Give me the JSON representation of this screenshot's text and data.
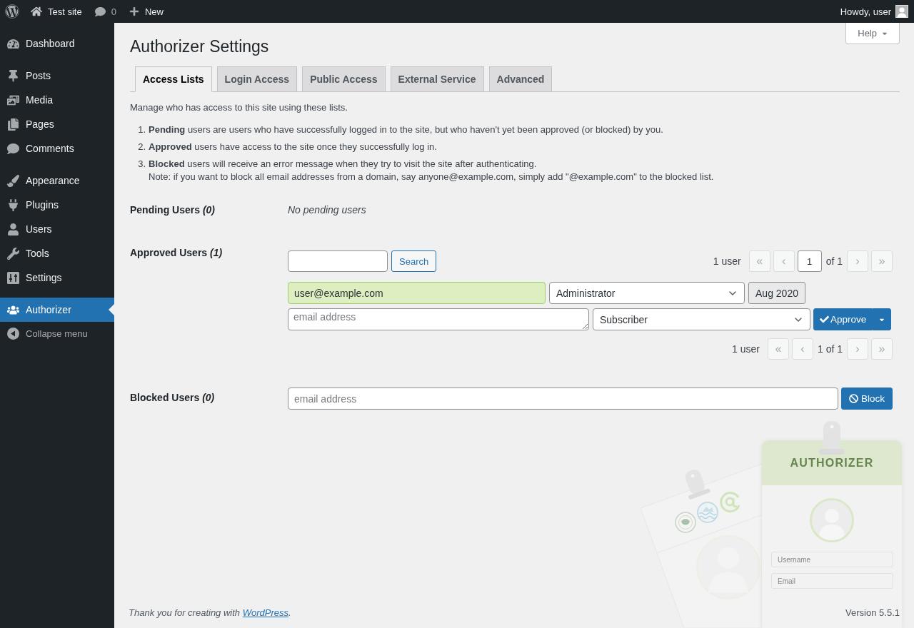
{
  "admin_bar": {
    "site_name": "Test site",
    "comment_count": "0",
    "new_label": "New",
    "greeting": "Howdy, user"
  },
  "sidebar": {
    "groups": [
      {
        "items": [
          {
            "label": "Dashboard",
            "selected": false
          }
        ]
      },
      {
        "items": [
          {
            "label": "Posts",
            "selected": false
          },
          {
            "label": "Media",
            "selected": false
          },
          {
            "label": "Pages",
            "selected": false
          },
          {
            "label": "Comments",
            "selected": false
          }
        ]
      },
      {
        "items": [
          {
            "label": "Appearance",
            "selected": false
          },
          {
            "label": "Plugins",
            "selected": false
          },
          {
            "label": "Users",
            "selected": false
          },
          {
            "label": "Tools",
            "selected": false
          },
          {
            "label": "Settings",
            "selected": false
          }
        ]
      },
      {
        "items": [
          {
            "label": "Authorizer",
            "selected": true
          }
        ]
      }
    ],
    "collapse_label": "Collapse menu"
  },
  "help_button": "Help",
  "page": {
    "title": "Authorizer Settings",
    "tabs": [
      {
        "label": "Access Lists",
        "selected": true
      },
      {
        "label": "Login Access",
        "selected": false
      },
      {
        "label": "Public Access",
        "selected": false
      },
      {
        "label": "External Service",
        "selected": false
      },
      {
        "label": "Advanced",
        "selected": false
      }
    ],
    "intro": "Manage who has access to this site using these lists.",
    "definitions": [
      {
        "number": "1.",
        "text": "**Pending** users are users who have successfully logged in to the site, but who haven't yet been approved (or blocked) by you."
      },
      {
        "number": "2.",
        "text": "**Approved** users have access to the site once they successfully log in."
      },
      {
        "number": "3.",
        "text": "**Blocked** users will receive an error message when they try to visit the site after authenticating.",
        "note": "Note: if you want to block all email addresses from a domain, say anyone@example.com, simply add \"@example.com\" to the blocked list."
      }
    ]
  },
  "pending_users": {
    "label": "Pending Users *(0)*",
    "empty_message": "No pending users"
  },
  "approved_users": {
    "label": "Approved Users *(1)*",
    "search_button": "Search",
    "pagination_top": {
      "count": "1 user",
      "first": {
        "label": "«",
        "disabled": true
      },
      "previous": {
        "label": "‹",
        "disabled": true
      },
      "page": "1",
      "total": "of 1",
      "next": {
        "label": "›",
        "disabled": true
      },
      "last": {
        "label": "»",
        "disabled": true
      }
    },
    "users": [
      {
        "email": "user@example.com",
        "highlighted": true,
        "role": "Administrator",
        "date": "Aug 2020"
      }
    ],
    "new_user": {
      "placeholder": "email address",
      "role": "Subscriber",
      "button": "Approve"
    },
    "pagination_bottom": {
      "count": "1 user",
      "first": {
        "label": "«",
        "disabled": true
      },
      "previous": {
        "label": "‹",
        "disabled": true
      },
      "status": "1 of 1",
      "next": {
        "label": "›",
        "disabled": true
      },
      "last": {
        "label": "»",
        "disabled": true
      }
    }
  },
  "blocked_users": {
    "label": "Blocked Users *(0)*",
    "placeholder": "email address",
    "button": "Block"
  },
  "footer": {
    "text_before": "Thank you for creating with ",
    "link": "WordPress",
    "text_after": ".",
    "version": "Version 5.5.1"
  },
  "illustration": {
    "title": "AUTHORIZER",
    "fields": [
      "Username",
      "Email"
    ]
  }
}
